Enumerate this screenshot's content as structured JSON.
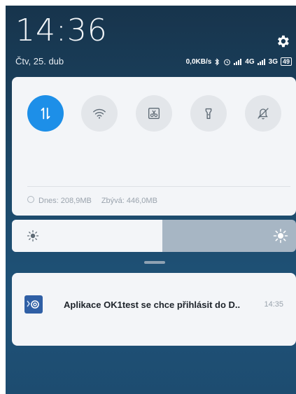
{
  "status": {
    "time": "14:36",
    "date": "Čtv, 25. dub",
    "network_speed": "0,0KB/s",
    "signal_1": "4G",
    "signal_2": "3G",
    "battery": "49"
  },
  "icons": {
    "settings": "gear-icon",
    "bluetooth": "bluetooth-icon",
    "alarm": "alarm-icon"
  },
  "quick_settings": {
    "toggles": [
      {
        "name": "mobile-data",
        "icon": "data-transfer-icon",
        "active": true
      },
      {
        "name": "wifi",
        "icon": "wifi-icon",
        "active": false
      },
      {
        "name": "screenshot",
        "icon": "scissors-icon",
        "active": false
      },
      {
        "name": "flashlight",
        "icon": "flashlight-icon",
        "active": false
      },
      {
        "name": "silent",
        "icon": "bell-off-icon",
        "active": false
      }
    ],
    "usage_today": "Dnes: 208,9MB",
    "usage_remaining": "Zbývá: 446,0MB"
  },
  "brightness": {
    "level": 0.53
  },
  "notification": {
    "app_icon": "app-mail-icon",
    "text": "Aplikace OK1test se chce přihlásit do D..",
    "time": "14:35"
  },
  "colors": {
    "accent": "#1d8fe8",
    "panel": "#f3f5f8",
    "background_top": "#17344c",
    "background_bottom": "#1f5278"
  }
}
